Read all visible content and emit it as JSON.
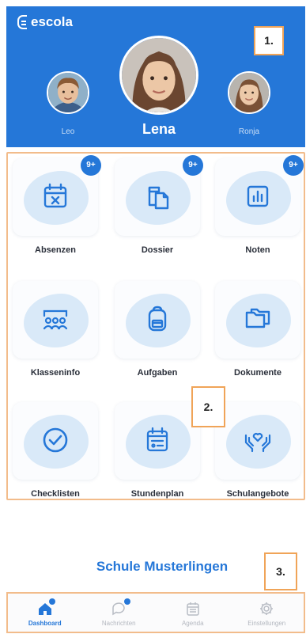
{
  "app": {
    "logo_text": "escola"
  },
  "children": {
    "selected": {
      "name": "Lena"
    },
    "left": {
      "name": "Leo"
    },
    "right": {
      "name": "Ronja"
    }
  },
  "markers": {
    "one": "1.",
    "two": "2.",
    "three": "3."
  },
  "tiles": [
    {
      "label": "Absenzen",
      "icon": "calendar-x-icon",
      "badge": "9+"
    },
    {
      "label": "Dossier",
      "icon": "clipboard-icon",
      "badge": "9+"
    },
    {
      "label": "Noten",
      "icon": "bar-chart-icon",
      "badge": "9+"
    },
    {
      "label": "Klasseninfo",
      "icon": "class-group-icon",
      "badge": ""
    },
    {
      "label": "Aufgaben",
      "icon": "backpack-icon",
      "badge": ""
    },
    {
      "label": "Dokumente",
      "icon": "folder-icon",
      "badge": ""
    },
    {
      "label": "Checklisten",
      "icon": "check-circle-icon",
      "badge": ""
    },
    {
      "label": "Stundenplan",
      "icon": "timetable-icon",
      "badge": ""
    },
    {
      "label": "Schulangebote",
      "icon": "heart-hands-icon",
      "badge": ""
    }
  ],
  "school": {
    "name": "Schule Musterlingen"
  },
  "nav": {
    "items": [
      {
        "label": "Dashboard",
        "icon": "home-icon",
        "active": true
      },
      {
        "label": "Nachrichten",
        "icon": "chat-icon",
        "active": false
      },
      {
        "label": "Agenda",
        "icon": "calendar-icon",
        "active": false
      },
      {
        "label": "Einstellungen",
        "icon": "gear-icon",
        "active": false
      }
    ]
  },
  "colors": {
    "brand": "#2577d8",
    "blob": "#d9e9f8",
    "annotation": "#f0a458"
  }
}
